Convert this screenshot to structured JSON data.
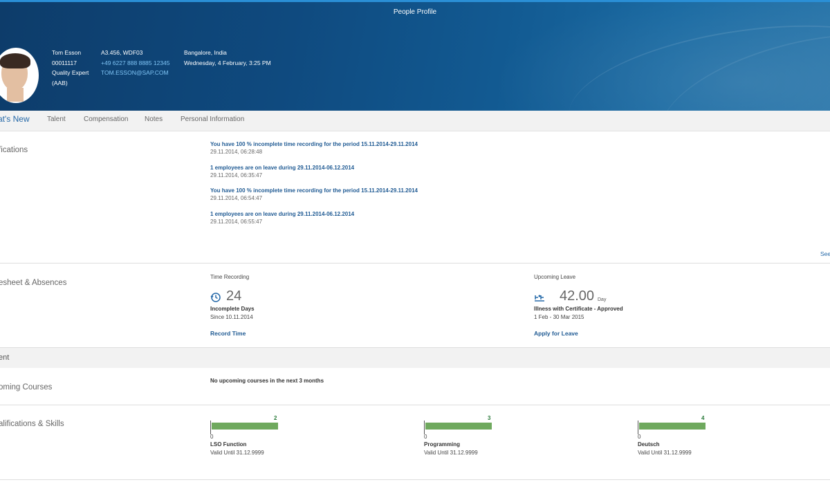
{
  "app": {
    "title": "People Profile"
  },
  "profile": {
    "name": "Tom Esson",
    "id": "00011117",
    "role": "Quality Expert",
    "role_code": "(AAB)",
    "office": "A3.456, WDF03",
    "phone": "+49 6227 888 8885 12345",
    "email": "TOM.ESSON@SAP.COM",
    "location": "Bangalore, India",
    "datetime": "Wednesday, 4 February, 3:25 PM"
  },
  "tabs": [
    {
      "label": "at's New"
    },
    {
      "label": "Talent"
    },
    {
      "label": "Compensation"
    },
    {
      "label": "Notes"
    },
    {
      "label": "Personal Information"
    }
  ],
  "notifications": {
    "section_title": "fications",
    "items": [
      {
        "title": "You have 100 % incomplete time recording for the period 15.11.2014-29.11.2014",
        "time": "29.11.2014, 06:28:48"
      },
      {
        "title": "1 employees are on leave during 29.11.2014-06.12.2014",
        "time": "29.11.2014, 06:35:47"
      },
      {
        "title": "You have 100 % incomplete time recording for the period 15.11.2014-29.11.2014",
        "time": "29.11.2014, 06:54:47"
      },
      {
        "title": "1 employees are on leave during 29.11.2014-06.12.2014",
        "time": "29.11.2014, 06:55:47"
      }
    ],
    "see_all": "See"
  },
  "timesheet": {
    "section_title": "esheet & Absences",
    "time_recording": {
      "header": "Time Recording",
      "value": "24",
      "label": "Incomplete Days",
      "since": "Since 10.11.2014",
      "action": "Record Time"
    },
    "upcoming_leave": {
      "header": "Upcoming Leave",
      "value": "42.00",
      "unit": "Day",
      "label": "Illness with Certificate - Approved",
      "range": "1 Feb - 30 Mar 2015",
      "action": "Apply for Leave"
    }
  },
  "talent": {
    "band_title": "ent",
    "courses": {
      "section_title": "oming Courses",
      "message": "No upcoming courses in the next 3 months"
    },
    "skills": {
      "section_title": "alifications & Skills",
      "max": 4,
      "items": [
        {
          "name": "LSO Function",
          "value": 2,
          "zero": "0",
          "valid": "Valid Until 31.12.9999"
        },
        {
          "name": "Programming",
          "value": 3,
          "zero": "0",
          "valid": "Valid Until 31.12.9999"
        },
        {
          "name": "Deutsch",
          "value": 4,
          "zero": "0",
          "valid": "Valid Until 31.12.9999"
        }
      ]
    }
  },
  "colors": {
    "header_bg": "#0f4a7f",
    "accent": "#2468a8",
    "link": "#7fc4f5",
    "skill_bar": "#6fa95e"
  }
}
